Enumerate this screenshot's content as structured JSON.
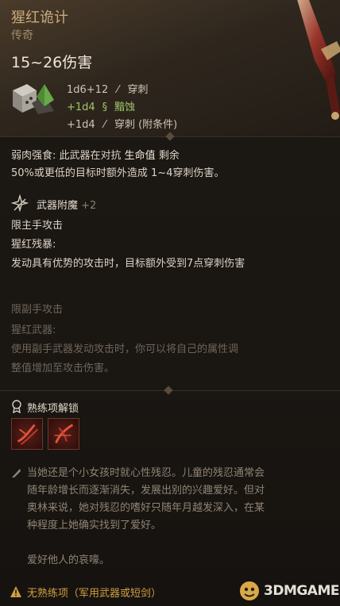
{
  "item": {
    "name": "猩红诡计",
    "rarity": "传奇",
    "damage_range": "15~26伤害",
    "damage_lines": [
      {
        "text_a": "1d6+12",
        "text_b": "穿刺",
        "style": "normal",
        "icon": "piercing-icon"
      },
      {
        "text_a": "+1d4",
        "text_b": "黯蚀",
        "style": "green",
        "icon": "necrotic-icon"
      },
      {
        "text_a": "+1d4",
        "text_b": "穿刺 (附条件)",
        "style": "normal",
        "icon": "piercing-icon"
      }
    ]
  },
  "passive": {
    "line1_prefix": "弱肉强食: 此武器在对抗",
    "line1_highlight": "生命值",
    "line1_suffix": "剩余",
    "line2": "50%或更低的目标时额外造成 1~4穿刺伤害。"
  },
  "enchant": {
    "label": "武器附魔",
    "bonus": "+2",
    "main_hand": {
      "restriction": "限主手攻击",
      "name": "猩红残暴:",
      "desc": "发动具有优势的攻击时，目标额外受到7点穿刺伤害"
    },
    "off_hand": {
      "restriction": "限副手攻击",
      "name": "猩红武器:",
      "desc1": "使用副手武器发动攻击时，你可以将自己的属性调",
      "desc2": "整值增加至攻击伤害。"
    }
  },
  "proficiency": {
    "header": "熟练项解锁",
    "slots": [
      "slot-1",
      "slot-2"
    ]
  },
  "lore": {
    "line1": "当她还是个小女孩时就心性残忍。儿童的残忍通常会",
    "line2": "随年龄增长而逐渐消失，发展出别的兴趣爱好。但对",
    "line3": "奥林来说，她对残忍的嗜好只随年月越发深入，在某",
    "line4": "种程度上她确实找到了爱好。",
    "line5": "爱好他人的哀嚎。"
  },
  "warning": "无熟练项（军用武器或短剑）",
  "watermark": "3DMGAME",
  "colors": {
    "title": "#c9a97a",
    "green": "#9fc56a",
    "warning": "#cf9f43",
    "dim": "#6e655a"
  }
}
